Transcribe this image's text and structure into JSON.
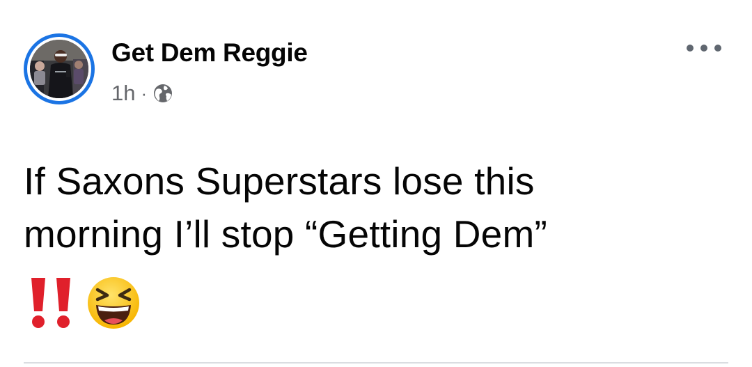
{
  "post": {
    "author_name": "Get Dem Reggie",
    "timestamp": "1h",
    "separator": "·",
    "privacy_icon": "globe-icon",
    "more_icon": "more-options-icon",
    "text_line_1": "If Saxons Superstars lose this",
    "text_line_2": "morning I’ll stop “Getting Dem”",
    "emojis": [
      "double-exclamation-icon",
      "laughing-face-icon"
    ]
  },
  "colors": {
    "story_ring": "#1b74e4",
    "meta_text": "#65676b",
    "body_text": "#050505",
    "divider": "#dadde1",
    "exclamation": "#e0202b",
    "emoji_face": "#ffcc33"
  }
}
